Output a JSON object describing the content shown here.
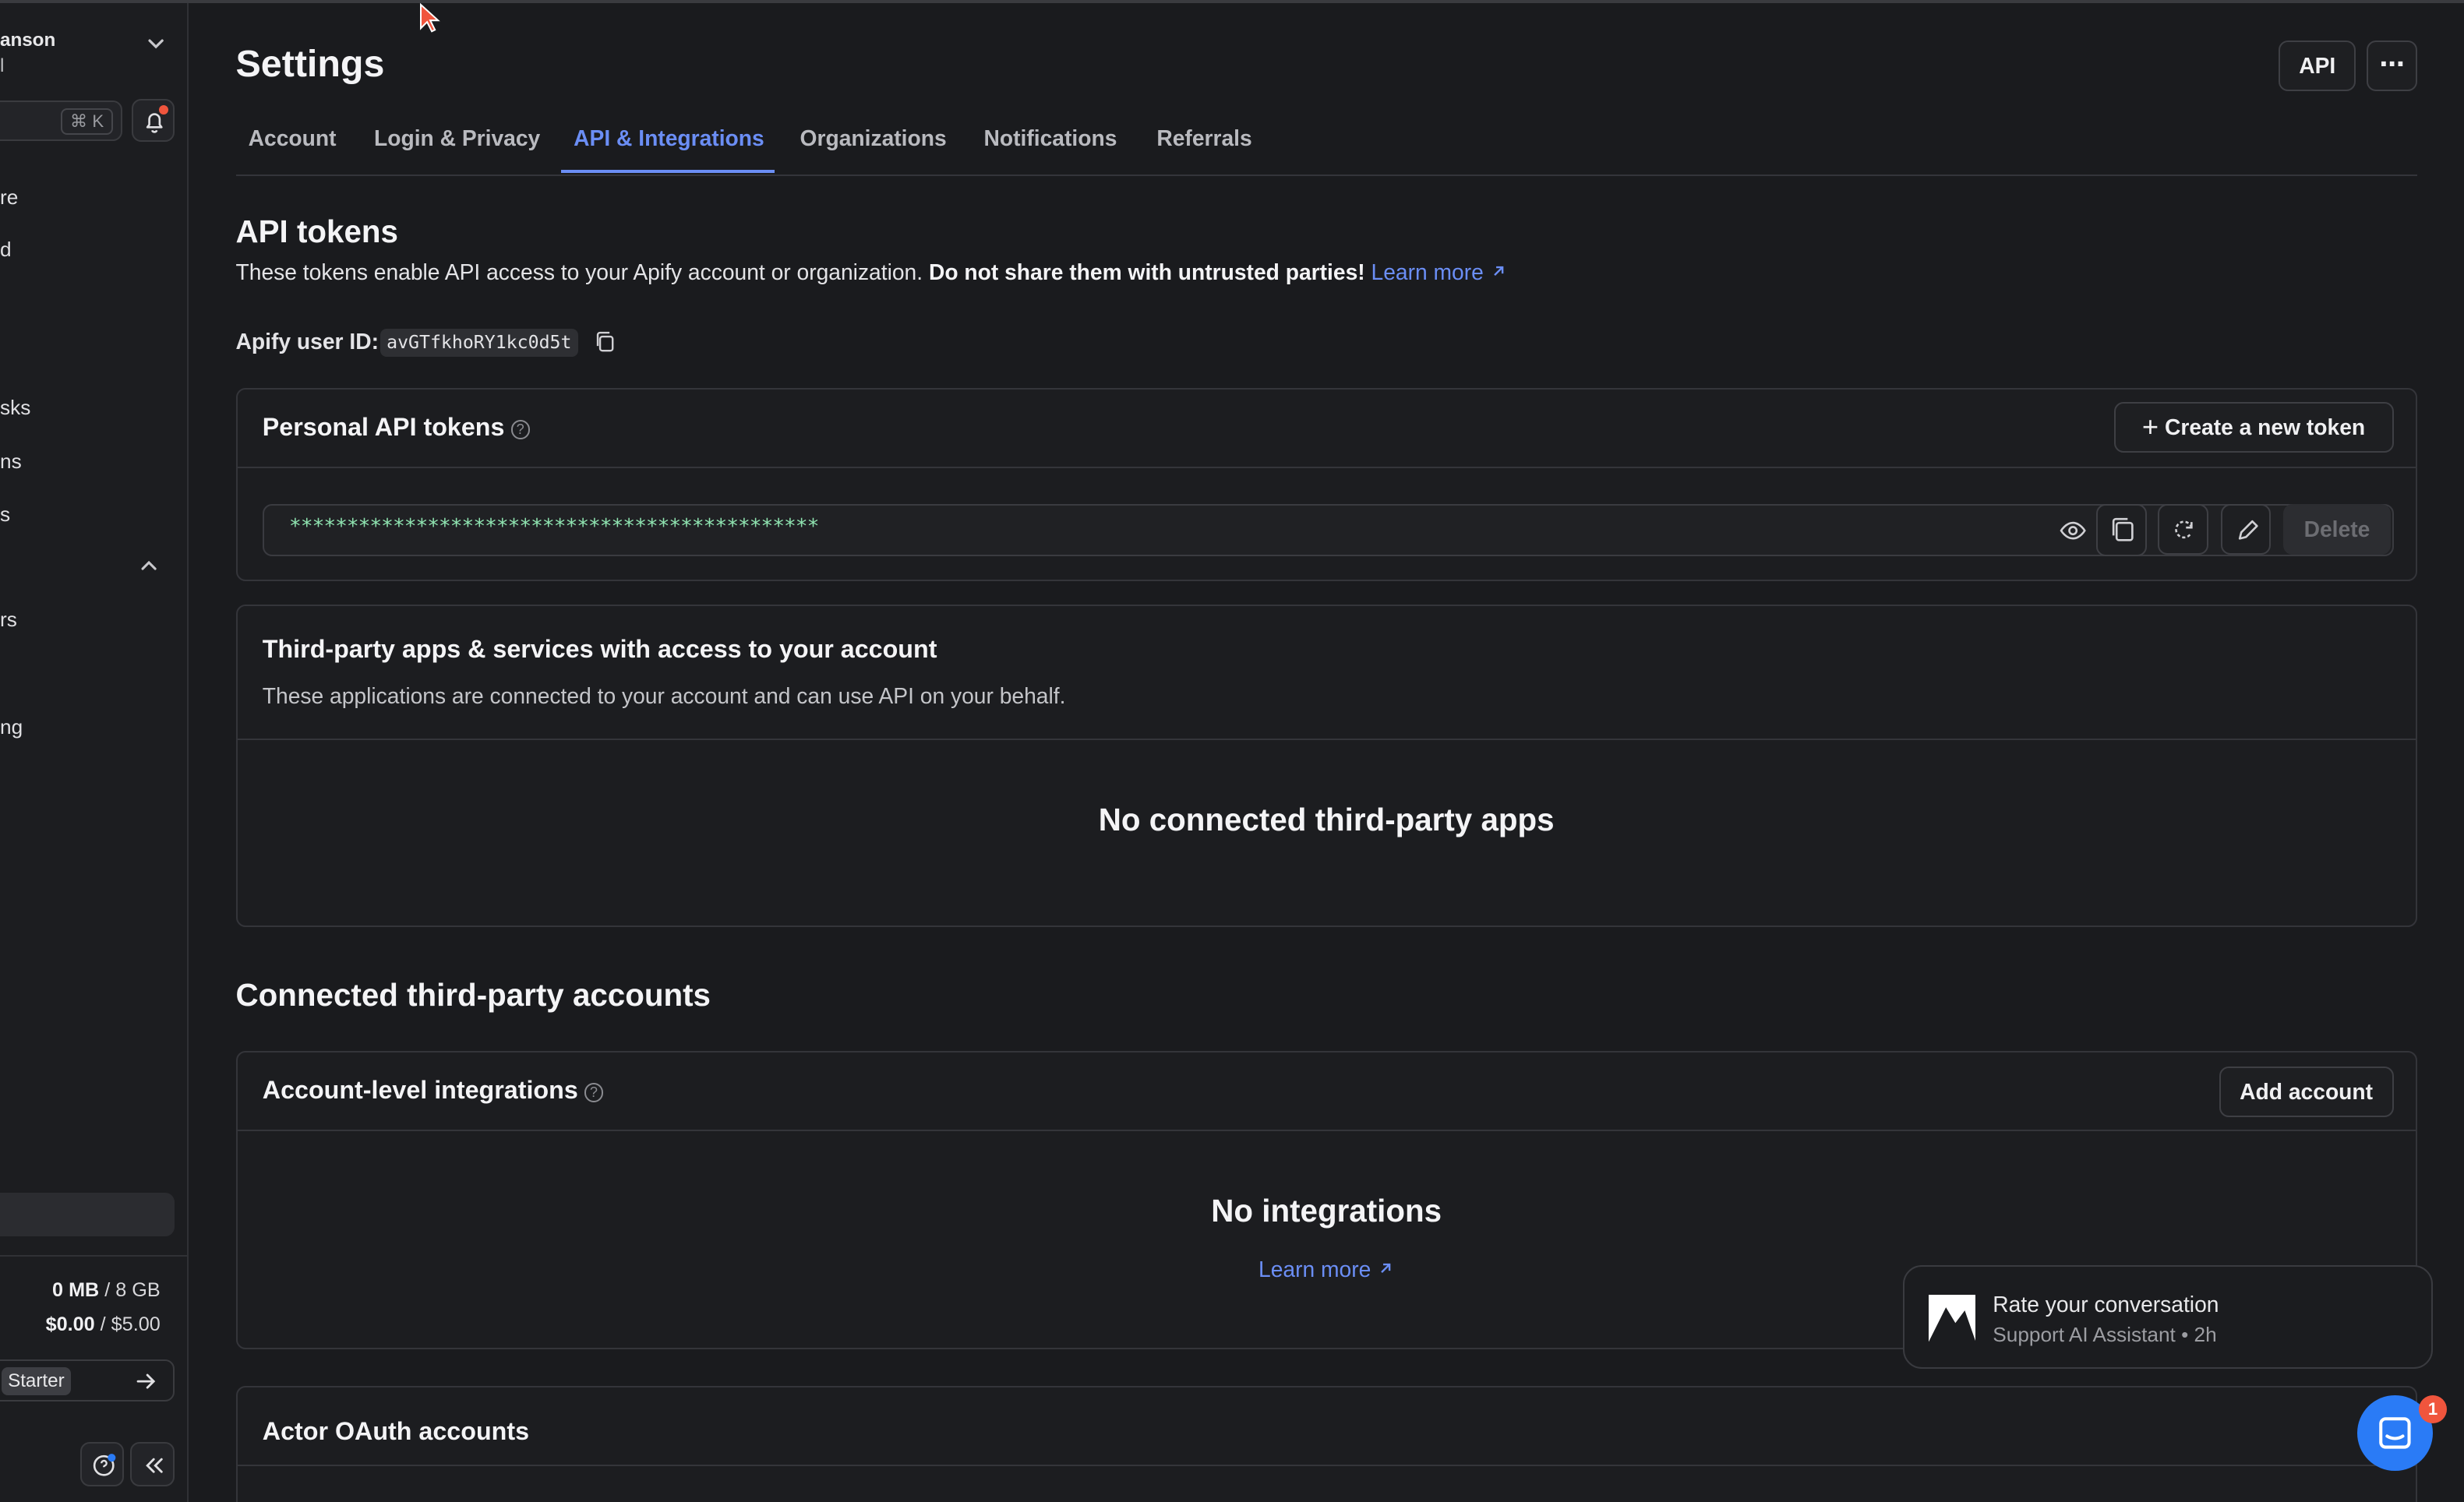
{
  "sidebar": {
    "account_name": "anson",
    "account_sub": "l",
    "search_shortcut": "⌘ K",
    "items": [
      {
        "label": "re"
      },
      {
        "label": "d"
      },
      {
        "label": "sks"
      },
      {
        "label": "ns"
      },
      {
        "label": "s"
      },
      {
        "label": "rs"
      },
      {
        "label": "ng"
      }
    ],
    "usage": {
      "storage_used": "0 MB",
      "storage_limit": "/ 8 GB",
      "cost_used": "$0.00",
      "cost_limit": "/ $5.00"
    },
    "plan_label": "Starter"
  },
  "header": {
    "title": "Settings",
    "api_button": "API",
    "more_button": "⋯"
  },
  "tabs": [
    {
      "label": "Account"
    },
    {
      "label": "Login & Privacy"
    },
    {
      "label": "API & Integrations",
      "active": true
    },
    {
      "label": "Organizations"
    },
    {
      "label": "Notifications"
    },
    {
      "label": "Referrals"
    }
  ],
  "api_tokens": {
    "title": "API tokens",
    "description_plain": "These tokens enable API access to your Apify account or organization.",
    "description_bold": "Do not share them with untrusted parties!",
    "learn_more": "Learn more",
    "user_id_label": "Apify user ID:",
    "user_id": "avGTfkhoRY1kc0d5t"
  },
  "personal_tokens": {
    "title": "Personal API tokens",
    "create_button": "Create a new token",
    "token_mask": "**********************************************",
    "delete_button": "Delete"
  },
  "third_party_apps": {
    "title": "Third-party apps & services with access to your account",
    "subtitle": "These applications are connected to your account and can use API on your behalf.",
    "empty": "No connected third-party apps"
  },
  "connected_accounts": {
    "title": "Connected third-party accounts",
    "account_level": {
      "title": "Account-level integrations",
      "add_button": "Add account",
      "empty": "No integrations",
      "learn_more": "Learn more"
    },
    "actor_oauth": {
      "title": "Actor OAuth accounts"
    }
  },
  "toast": {
    "title": "Rate your conversation",
    "subtitle": "Support AI Assistant • 2h"
  },
  "chat": {
    "badge": "1"
  },
  "colors": {
    "accent": "#6b8ef5",
    "background": "#1a1b1e",
    "token_text": "#8fe3b0",
    "notification": "#f0553d",
    "chat_button": "#2a7bf6"
  }
}
